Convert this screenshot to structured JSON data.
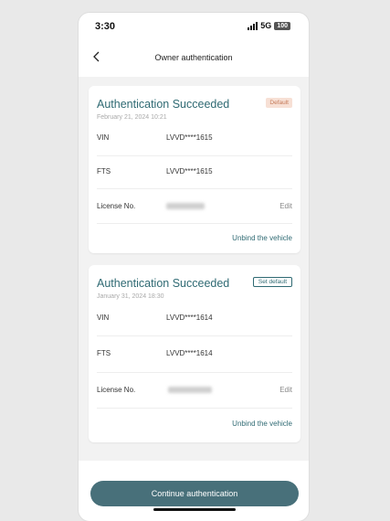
{
  "status_bar": {
    "time": "3:30",
    "network": "5G",
    "battery": "100"
  },
  "nav": {
    "title": "Owner authentication"
  },
  "cards": [
    {
      "title": "Authentication Succeeded",
      "badge": "Default",
      "date": "February 21, 2024 10:21",
      "vin_label": "VIN",
      "vin_value": "LVVD****1615",
      "fts_label": "FTS",
      "fts_value": "LVVD****1615",
      "license_label": "License No.",
      "edit_label": "Edit",
      "unbind_label": "Unbind the vehicle"
    },
    {
      "title": "Authentication Succeeded",
      "badge": "Set default",
      "date": "January 31, 2024 18:30",
      "vin_label": "VIN",
      "vin_value": "LVVD****1614",
      "fts_label": "FTS",
      "fts_value": "LVVD****1614",
      "license_label": "License No.",
      "edit_label": "Edit",
      "unbind_label": "Unbind the vehicle"
    }
  ],
  "continue_button": "Continue authentication",
  "colors": {
    "accent": "#2f6a73",
    "button": "#48707a",
    "default_badge_bg": "#f7e0d5"
  }
}
